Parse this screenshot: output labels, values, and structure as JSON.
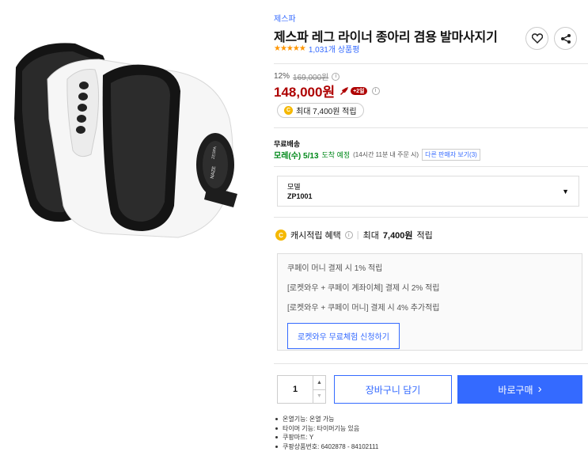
{
  "product": {
    "brand": "제스파",
    "title": "제스파 레그 라이너 종아리 겸용 발마사지기",
    "rating_count": "1,031개 상품평",
    "stars": "★★★★★"
  },
  "device_labels": {
    "brand_badge": "ZESPA",
    "model_badge": "NAZE"
  },
  "price": {
    "discount_rate": "12%",
    "original_price": "169,000원",
    "sale_price": "148,000원",
    "rocket_badge": "+2일",
    "cashback_pill": "최대 7,400원 적립"
  },
  "shipping": {
    "label": "무료배송",
    "arrival": "모레(수) 5/13",
    "arrival_suffix": "도착 예정",
    "cutoff": "(14시간 11분 내 주문 시)",
    "other_sellers": "다른 판매자 보기(3)"
  },
  "option": {
    "label": "모델",
    "value": "ZP1001"
  },
  "benefit": {
    "title": "캐시적립 혜택",
    "separator": "|",
    "max_text": "최대",
    "max_amount": "7,400원",
    "suffix": "적립"
  },
  "benefit_box": {
    "lines": [
      "쿠페이 머니 결제 시 1% 적립",
      "[로켓와우 + 쿠페이 계좌이체] 결제 시 2% 적립",
      "[로켓와우 + 쿠페이 머니] 결제 시 4% 추가적립"
    ],
    "trial_button": "로켓와우 무료체험 신청하기"
  },
  "purchase": {
    "quantity": "1",
    "cart_button": "장바구니 담기",
    "buy_button": "바로구매",
    "buy_arrow": "›"
  },
  "specs": [
    "온열기능: 온열 가능",
    "타이머 기능: 타이머기능 있음",
    "쿠팡마트: Y",
    "쿠팡상품번호: 6402878 - 84102111"
  ],
  "colors": {
    "accent_blue": "#346aff",
    "price_red": "#ae0000",
    "star_orange": "#ff9600",
    "arrival_green": "#00891a",
    "coin_yellow": "#f5b800"
  },
  "icons": {
    "wishlist": "heart-icon",
    "share": "share-icon",
    "info": "info-icon",
    "dropdown": "caret-down-icon",
    "coin": "cash-coin-icon",
    "rocket": "rocket-icon"
  }
}
